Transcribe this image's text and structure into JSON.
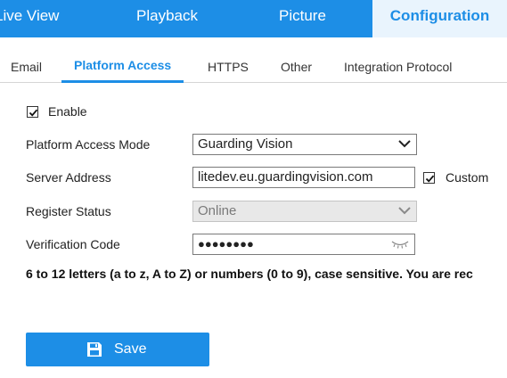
{
  "topnav": {
    "items": [
      {
        "label": "Live View"
      },
      {
        "label": "Playback"
      },
      {
        "label": "Picture"
      },
      {
        "label": "Configuration"
      }
    ],
    "active": "Configuration"
  },
  "subtabs": {
    "items": [
      {
        "label": "Email"
      },
      {
        "label": "Platform Access"
      },
      {
        "label": "HTTPS"
      },
      {
        "label": "Other"
      },
      {
        "label": "Integration Protocol"
      }
    ],
    "active": "Platform Access"
  },
  "form": {
    "enable": {
      "label": "Enable",
      "checked": true
    },
    "platform_access_mode": {
      "label": "Platform Access Mode",
      "value": "Guarding Vision",
      "icon": "chevron-down-icon"
    },
    "server_address": {
      "label": "Server Address",
      "value": "litedev.eu.guardingvision.com"
    },
    "custom": {
      "label": "Custom",
      "checked": true
    },
    "register_status": {
      "label": "Register Status",
      "value": "Online",
      "disabled": true,
      "icon": "chevron-down-icon"
    },
    "verification_code": {
      "label": "Verification Code",
      "value": "●●●●●●●●",
      "icon": "eye-closed-icon"
    }
  },
  "hint": "6 to 12 letters (a to z, A to Z) or numbers (0 to 9), case sensitive. You are rec",
  "save_button": {
    "label": "Save",
    "icon": "floppy-disk-icon"
  },
  "colors": {
    "accent": "#1d8ee6",
    "active_tab_bg": "#e9f4fd",
    "disabled_field_bg": "#e8e8e8"
  }
}
